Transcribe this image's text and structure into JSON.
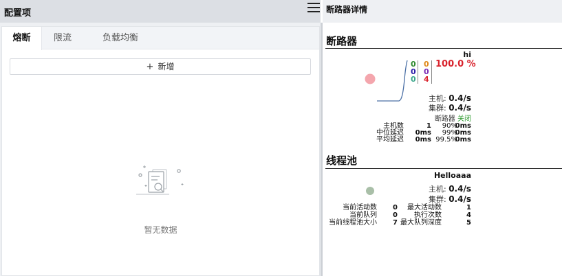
{
  "left_panel": {
    "title": "配置项",
    "tabs": [
      {
        "label": "熔断",
        "active": true
      },
      {
        "label": "限流",
        "active": false
      },
      {
        "label": "负载均衡",
        "active": false
      }
    ],
    "add_button": {
      "icon": "plus-icon",
      "label": "新增"
    },
    "empty_state": {
      "icon": "empty-document-search-icon",
      "text": "暂无数据"
    }
  },
  "right_panel": {
    "menu_icon": "hamburger-menu-icon",
    "title": "断路器详情",
    "circuit_breaker": {
      "section_title": "断路器",
      "name": "hi",
      "counts": {
        "col1": [
          "0",
          "0",
          "0"
        ],
        "col2": [
          "0",
          "0",
          "4"
        ]
      },
      "error_pct": "100.0 %",
      "host_rate_label": "主机:",
      "host_rate_value": "0.4/s",
      "cluster_rate_label": "集群:",
      "cluster_rate_value": "0.4/s",
      "breaker_label": "断路器",
      "breaker_status": "关闭",
      "stats": [
        {
          "label": "主机数",
          "value": "1",
          "p": "90%",
          "pv": "0ms"
        },
        {
          "label": "中位延迟",
          "value": "0ms",
          "p": "99%",
          "pv": "0ms"
        },
        {
          "label": "平均延迟",
          "value": "0ms",
          "p": "99.5%",
          "pv": "0ms"
        }
      ],
      "colors": {
        "circle": "#f4a6ad",
        "sparkline": "#4a6fa5",
        "error": "#d9232d"
      }
    },
    "thread_pool": {
      "section_title": "线程池",
      "name": "Helloaaa",
      "host_rate_label": "主机:",
      "host_rate_value": "0.4/s",
      "cluster_rate_label": "集群:",
      "cluster_rate_value": "0.4/s",
      "stats": [
        {
          "label": "当前活动数",
          "value": "0",
          "label2": "最大活动数",
          "value2": "1"
        },
        {
          "label": "当前队列",
          "value": "0",
          "label2": "执行次数",
          "value2": "4"
        },
        {
          "label": "当前线程池大小",
          "value": "7",
          "label2": "最大队列深度",
          "value2": "5"
        }
      ],
      "colors": {
        "circle": "#a9bfa8"
      }
    }
  }
}
